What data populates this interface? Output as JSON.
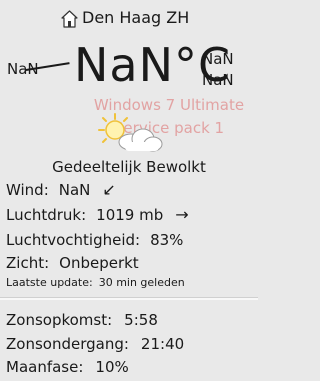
{
  "location": {
    "name": "Den Haag ZH",
    "icon": "home-icon"
  },
  "temperature": {
    "current": "NaN°C",
    "low_left": "NaN",
    "high_right_1": "NaN",
    "high_right_2": "NaN"
  },
  "watermark": {
    "line1": "Windows 7 Ultimate",
    "line2": "Service pack 1"
  },
  "weather_icon": "partly-cloudy-icon",
  "condition": "Gedeeltelijk Bewolkt",
  "details": {
    "wind_label": "Wind:",
    "wind_value": "NaN",
    "wind_arrow": "↙",
    "pressure_label": "Luchtdruk:",
    "pressure_value": "1019 mb",
    "pressure_arrow": "→",
    "humidity_label": "Luchtvochtigheid:",
    "humidity_value": "83%",
    "visibility_label": "Zicht:",
    "visibility_value": "Onbeperkt",
    "update_label": "Laatste update:",
    "update_value": "30 min geleden"
  },
  "astro": {
    "sunrise_label": "Zonsopkomst:",
    "sunrise_value": "5:58",
    "sunset_label": "Zonsondergang:",
    "sunset_value": "21:40",
    "moon_label": "Maanfase:",
    "moon_value": "10%"
  },
  "colors": {
    "background": "#e9e9e9",
    "text": "#1a1a1a",
    "watermark": "#e2a3a3"
  }
}
